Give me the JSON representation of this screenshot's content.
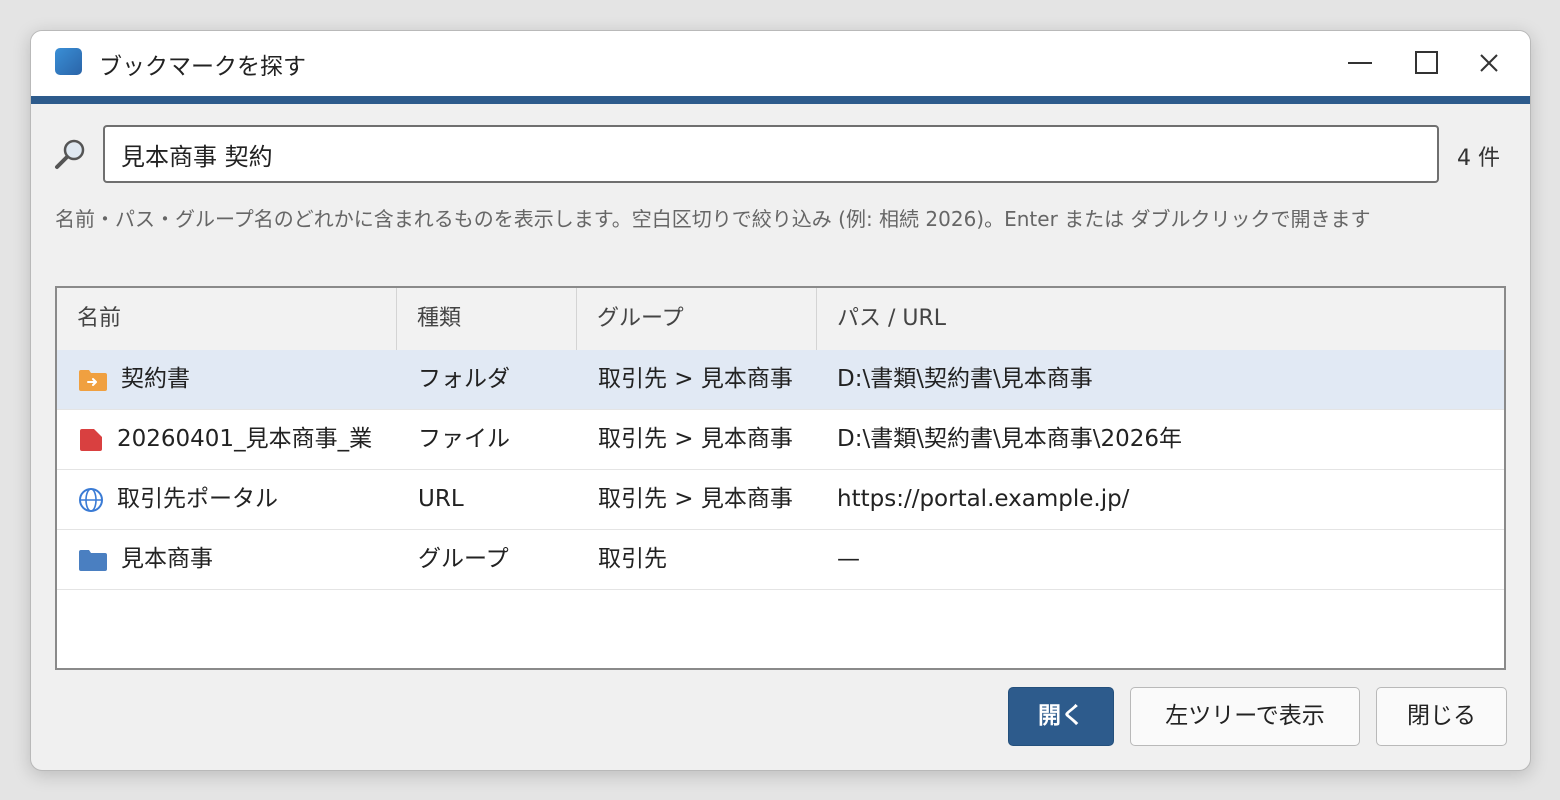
{
  "window": {
    "title": "ブックマークを探す",
    "app_icon": "app-icon",
    "controls": [
      "minimize-icon",
      "maximize-icon",
      "close-icon"
    ]
  },
  "search": {
    "value": "見本商事 契約",
    "count": "4 件",
    "hint": "名前・パス・グループ名のどれかに含まれるものを表示します。空白区切りで絞り込み (例: 相続 2026)。Enter または ダブルクリックで開きます"
  },
  "table": {
    "headers": [
      "名前",
      "種類",
      "グループ",
      "パス / URL"
    ],
    "rows": [
      {
        "icon": "folder-link-icon",
        "name": "契約書",
        "type": "フォルダ",
        "group": "取引先 > 見本商事",
        "path": "D:\\書類\\契約書\\見本商事",
        "selected": true
      },
      {
        "icon": "file-icon",
        "name": "20260401_見本商事_業",
        "type": "ファイル",
        "group": "取引先 > 見本商事",
        "path": "D:\\書類\\契約書\\見本商事\\2026年",
        "selected": false
      },
      {
        "icon": "globe-icon",
        "name": "取引先ポータル",
        "type": "URL",
        "group": "取引先 > 見本商事",
        "path": "https://portal.example.jp/",
        "selected": false
      },
      {
        "icon": "group-folder-icon",
        "name": "見本商事",
        "type": "グループ",
        "group": "取引先",
        "path": "—",
        "selected": false
      }
    ]
  },
  "buttons": {
    "open": "開く",
    "show_in_tree": "左ツリーで表示",
    "close": "閉じる"
  },
  "colors": {
    "accent": "#2d5b8c",
    "selected_row": "#e1e9f4",
    "folder_link": "#f0a040",
    "file": "#d94040",
    "globe": "#3a7bd5",
    "group_folder": "#4a7fc1"
  }
}
